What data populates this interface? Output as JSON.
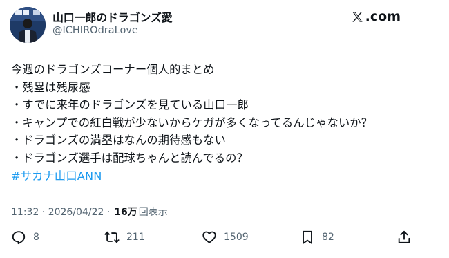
{
  "author": {
    "display_name": "山口一郎のドラゴンズ愛",
    "handle": "@ICHIROdraLove"
  },
  "brand": {
    "logo_text": ".com"
  },
  "tweet": {
    "lines": [
      "今週のドラゴンズコーナー個人的まとめ",
      "・残塁は残尿感",
      "・すでに来年のドラゴンズを見ている山口一郎",
      "・キャンプでの紅白戦が少ないからケガが多くなってるんじゃないか？",
      "・ドラゴンズの満塁はなんの期待感もない",
      "・ドラゴンズ選手は配球ちゃんと読んでるの？"
    ],
    "hashtag": "#サカナ山口ANN"
  },
  "meta": {
    "timestamp": "11:32 · 2026/04/22 ·",
    "views_count": "16万",
    "views_label": "回表示"
  },
  "actions": {
    "reply_count": "8",
    "repost_count": "211",
    "like_count": "1509",
    "bookmark_count": "82"
  },
  "colors": {
    "text": "#0f1419",
    "secondary": "#536471",
    "link": "#1d9bf0"
  },
  "icons": {
    "reply": "reply-icon",
    "repost": "repost-icon",
    "like": "heart-icon",
    "bookmark": "bookmark-icon",
    "share": "share-icon",
    "logo": "x-logo-icon"
  }
}
